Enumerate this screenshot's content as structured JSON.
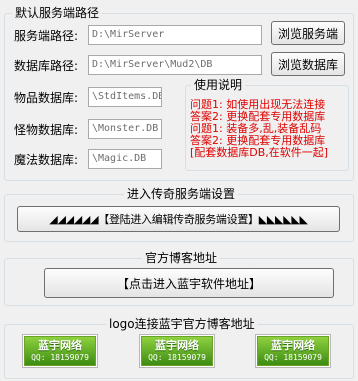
{
  "server_group": {
    "title": "默认服务端路径",
    "server_path": {
      "label": "服务端路径:",
      "value": "D:\\MirServer",
      "browse": "浏览服务端"
    },
    "db_path": {
      "label": "数据库路径:",
      "value": "D:\\MirServer\\Mud2\\DB",
      "browse": "浏览数据库"
    },
    "items_db": {
      "label": "物品数据库:",
      "value": "\\StdItems.DB"
    },
    "monster_db": {
      "label": "怪物数据库:",
      "value": "\\Monster.DB"
    },
    "magic_db": {
      "label": "魔法数据库:",
      "value": "\\Magic.DB"
    },
    "help": {
      "title": "使用说明",
      "lines": [
        "问题1: 如使用出现无法连接",
        "答案2: 更换配套专用数据库",
        "问题1: 装备多,乱,装备乱码",
        "答案2: 更换配套专用数据库",
        "[配套数据库DB,在软件一起]"
      ]
    }
  },
  "settings_section": {
    "title": "进入传奇服务端设置",
    "button": "◢◢◢◢◢◢【登陆进入编辑传奇服务端设置】◣◣◣◣◣◣"
  },
  "blog_section": {
    "title": "官方博客地址",
    "button": "【点击进入蓝宇软件地址】"
  },
  "logo_section": {
    "title": "logo连接蓝宇官方博客地址",
    "logos": [
      {
        "name": "蓝宇网络",
        "qq": "QQ: 18159079"
      },
      {
        "name": "蓝宇网络",
        "qq": "QQ: 18159079"
      },
      {
        "name": "蓝宇网络",
        "qq": "QQ: 18159079"
      }
    ]
  },
  "colors": {
    "help_text": "#e00000",
    "logo_green": "#5aa81e"
  }
}
